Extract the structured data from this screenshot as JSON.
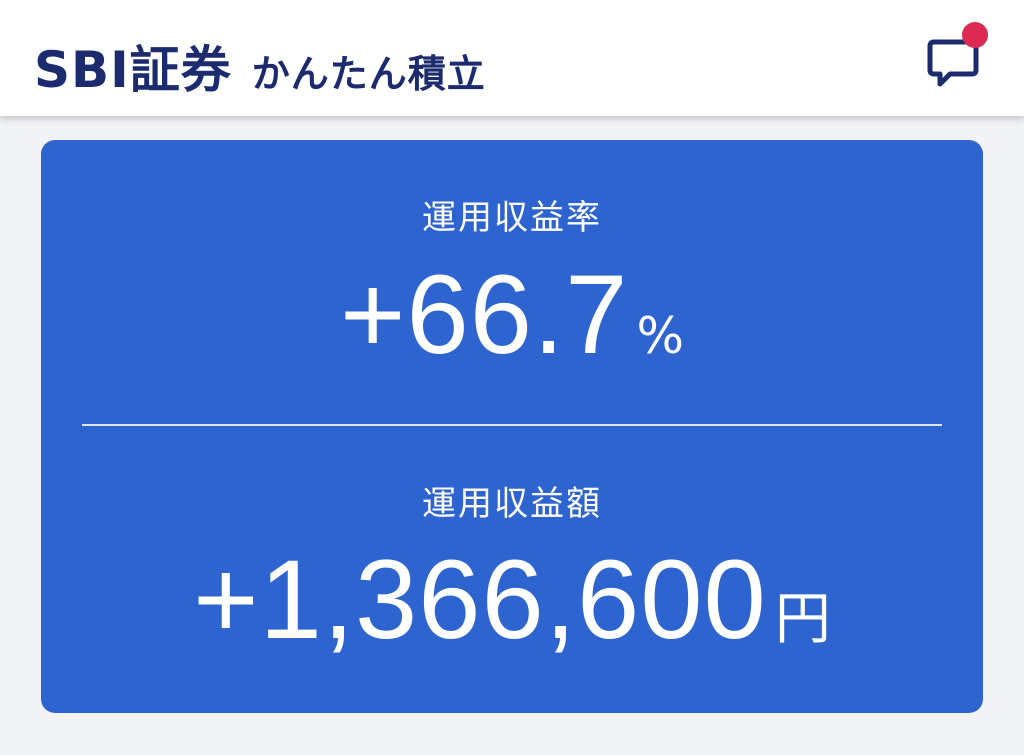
{
  "header": {
    "brand_name": "SBI証券",
    "service_name": "かんたん積立",
    "has_notification": true,
    "notification_color": "#de2a53",
    "brand_color": "#1c2b6e",
    "message_icon": "chat-bubble-icon"
  },
  "summary": {
    "background_color": "#2e64d0",
    "return_rate": {
      "label": "運用収益率",
      "value": "+66.7",
      "unit": "%"
    },
    "return_amount": {
      "label": "運用収益額",
      "value": "+1,366,600",
      "unit": "円"
    }
  }
}
